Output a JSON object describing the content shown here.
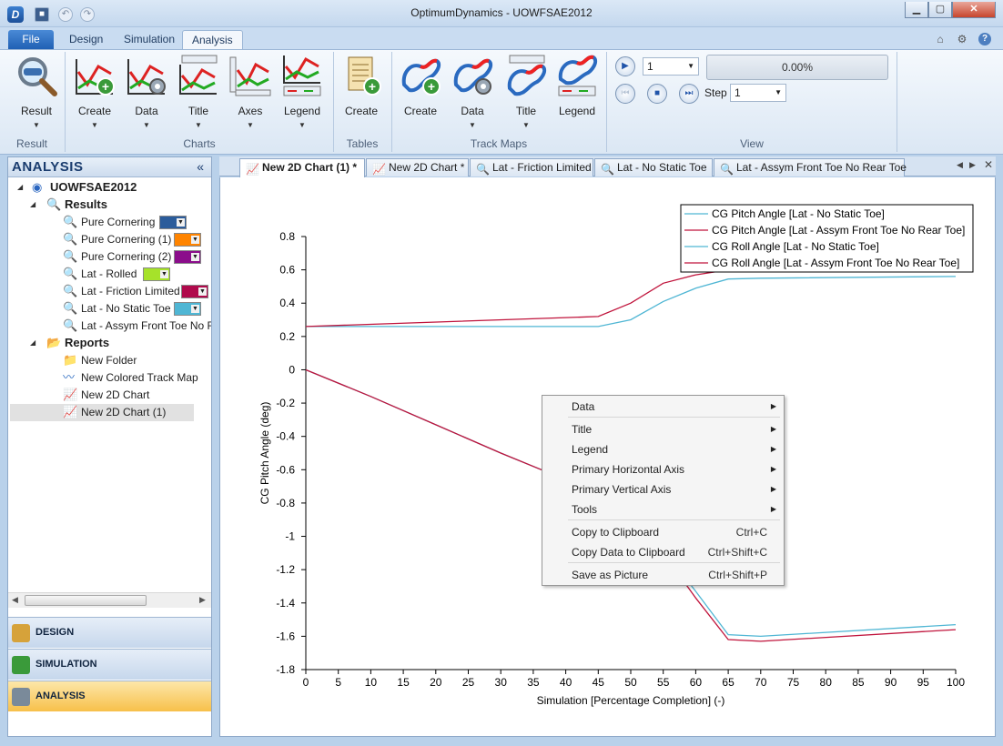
{
  "window": {
    "title": "OptimumDynamics - UOWFSAE2012",
    "minimize": "▁",
    "maximize": "▢",
    "close": "✕"
  },
  "ribbon_tabs": {
    "file": "File",
    "design": "Design",
    "simulation": "Simulation",
    "analysis": "Analysis"
  },
  "ribbon": {
    "result_btn": "Result",
    "charts_create": "Create",
    "charts_data": "Data",
    "charts_title": "Title",
    "charts_axes": "Axes",
    "charts_legend": "Legend",
    "tables_create": "Create",
    "tm_create": "Create",
    "tm_data": "Data",
    "tm_title": "Title",
    "tm_legend": "Legend",
    "groups": {
      "result": "Result",
      "charts": "Charts",
      "tables": "Tables",
      "track_maps": "Track Maps",
      "view": "View"
    },
    "view": {
      "speed_value": "1",
      "step_label": "Step",
      "step_value": "1",
      "progress": "0.00%"
    }
  },
  "left_pane": {
    "title": "ANALYSIS",
    "collapse": "«",
    "tree": {
      "project": "UOWFSAE2012",
      "results_label": "Results",
      "results": [
        {
          "label": "Pure Cornering",
          "color": "#2b5c9b"
        },
        {
          "label": "Pure Cornering (1)",
          "color": "#ff8400"
        },
        {
          "label": "Pure Cornering (2)",
          "color": "#8b0d8b"
        },
        {
          "label": "Lat - Rolled",
          "color": "#a6e22a"
        },
        {
          "label": "Lat - Friction Limited",
          "color": "#b00a4c"
        },
        {
          "label": "Lat - No Static Toe",
          "color": "#4fb6d4"
        },
        {
          "label": "Lat - Assym Front Toe No Rear Toe"
        }
      ],
      "reports_label": "Reports",
      "reports": [
        "New Folder",
        "New Colored Track Map",
        "New 2D Chart",
        "New 2D Chart (1)"
      ]
    },
    "nav": {
      "design": "DESIGN",
      "simulation": "SIMULATION",
      "analysis": "ANALYSIS"
    }
  },
  "doc_tabs": [
    "New 2D Chart (1) *",
    "New 2D Chart *",
    "Lat - Friction Limited",
    "Lat - No Static Toe",
    "Lat - Assym Front Toe No Rear Toe"
  ],
  "chart_data": {
    "type": "line",
    "xlabel": "Simulation [Percentage Completion] (-)",
    "ylabel": "CG Pitch Angle (deg)",
    "xlim": [
      0,
      100
    ],
    "ylim": [
      -1.8,
      0.8
    ],
    "xticks": [
      0,
      5,
      10,
      15,
      20,
      25,
      30,
      35,
      40,
      45,
      50,
      55,
      60,
      65,
      70,
      75,
      80,
      85,
      90,
      95,
      100
    ],
    "yticks": [
      0.8,
      0.6,
      0.4,
      0.2,
      0,
      -0.2,
      -0.4,
      -0.6,
      -0.8,
      -1,
      -1.2,
      -1.4,
      -1.6,
      -1.8
    ],
    "legend_position": "top-right",
    "series": [
      {
        "name": "CG Pitch Angle [Lat - No Static Toe]",
        "color": "#4fb6d4",
        "x": [
          0,
          45,
          50,
          55,
          60,
          65,
          70,
          100
        ],
        "y": [
          0.26,
          0.26,
          0.3,
          0.41,
          0.49,
          0.545,
          0.55,
          0.56
        ]
      },
      {
        "name": "CG Pitch Angle [Lat - Assym Front Toe No Rear Toe]",
        "color": "#c0143c",
        "x": [
          0,
          45,
          50,
          55,
          60,
          65,
          70,
          100
        ],
        "y": [
          0.26,
          0.32,
          0.4,
          0.52,
          0.57,
          0.6,
          0.62,
          0.65
        ]
      },
      {
        "name": "CG Roll Angle [Lat - No Static Toe]",
        "color": "#4fb6d4",
        "x": [
          0,
          10,
          20,
          30,
          40,
          45,
          50,
          55,
          60,
          65,
          70,
          100
        ],
        "y": [
          0,
          -0.16,
          -0.33,
          -0.5,
          -0.66,
          -0.74,
          -0.9,
          -1.08,
          -1.33,
          -1.59,
          -1.6,
          -1.53
        ]
      },
      {
        "name": "CG Roll Angle [Lat - Assym Front Toe No Rear Toe]",
        "color": "#c0143c",
        "x": [
          0,
          10,
          20,
          30,
          40,
          45,
          50,
          55,
          60,
          65,
          70,
          100
        ],
        "y": [
          0,
          -0.16,
          -0.33,
          -0.5,
          -0.66,
          -0.74,
          -0.92,
          -1.1,
          -1.37,
          -1.62,
          -1.63,
          -1.56
        ]
      }
    ]
  },
  "context_menu": {
    "items": [
      {
        "label": "Data",
        "submenu": true
      },
      {
        "label": "Title",
        "submenu": true
      },
      {
        "label": "Legend",
        "submenu": true
      },
      {
        "label": "Primary Horizontal Axis",
        "submenu": true
      },
      {
        "label": "Primary Vertical Axis",
        "submenu": true
      },
      {
        "label": "Tools",
        "submenu": true
      },
      {
        "label": "Copy to Clipboard",
        "shortcut": "Ctrl+C"
      },
      {
        "label": "Copy Data to Clipboard",
        "shortcut": "Ctrl+Shift+C"
      },
      {
        "label": "Save as Picture",
        "shortcut": "Ctrl+Shift+P"
      }
    ]
  }
}
